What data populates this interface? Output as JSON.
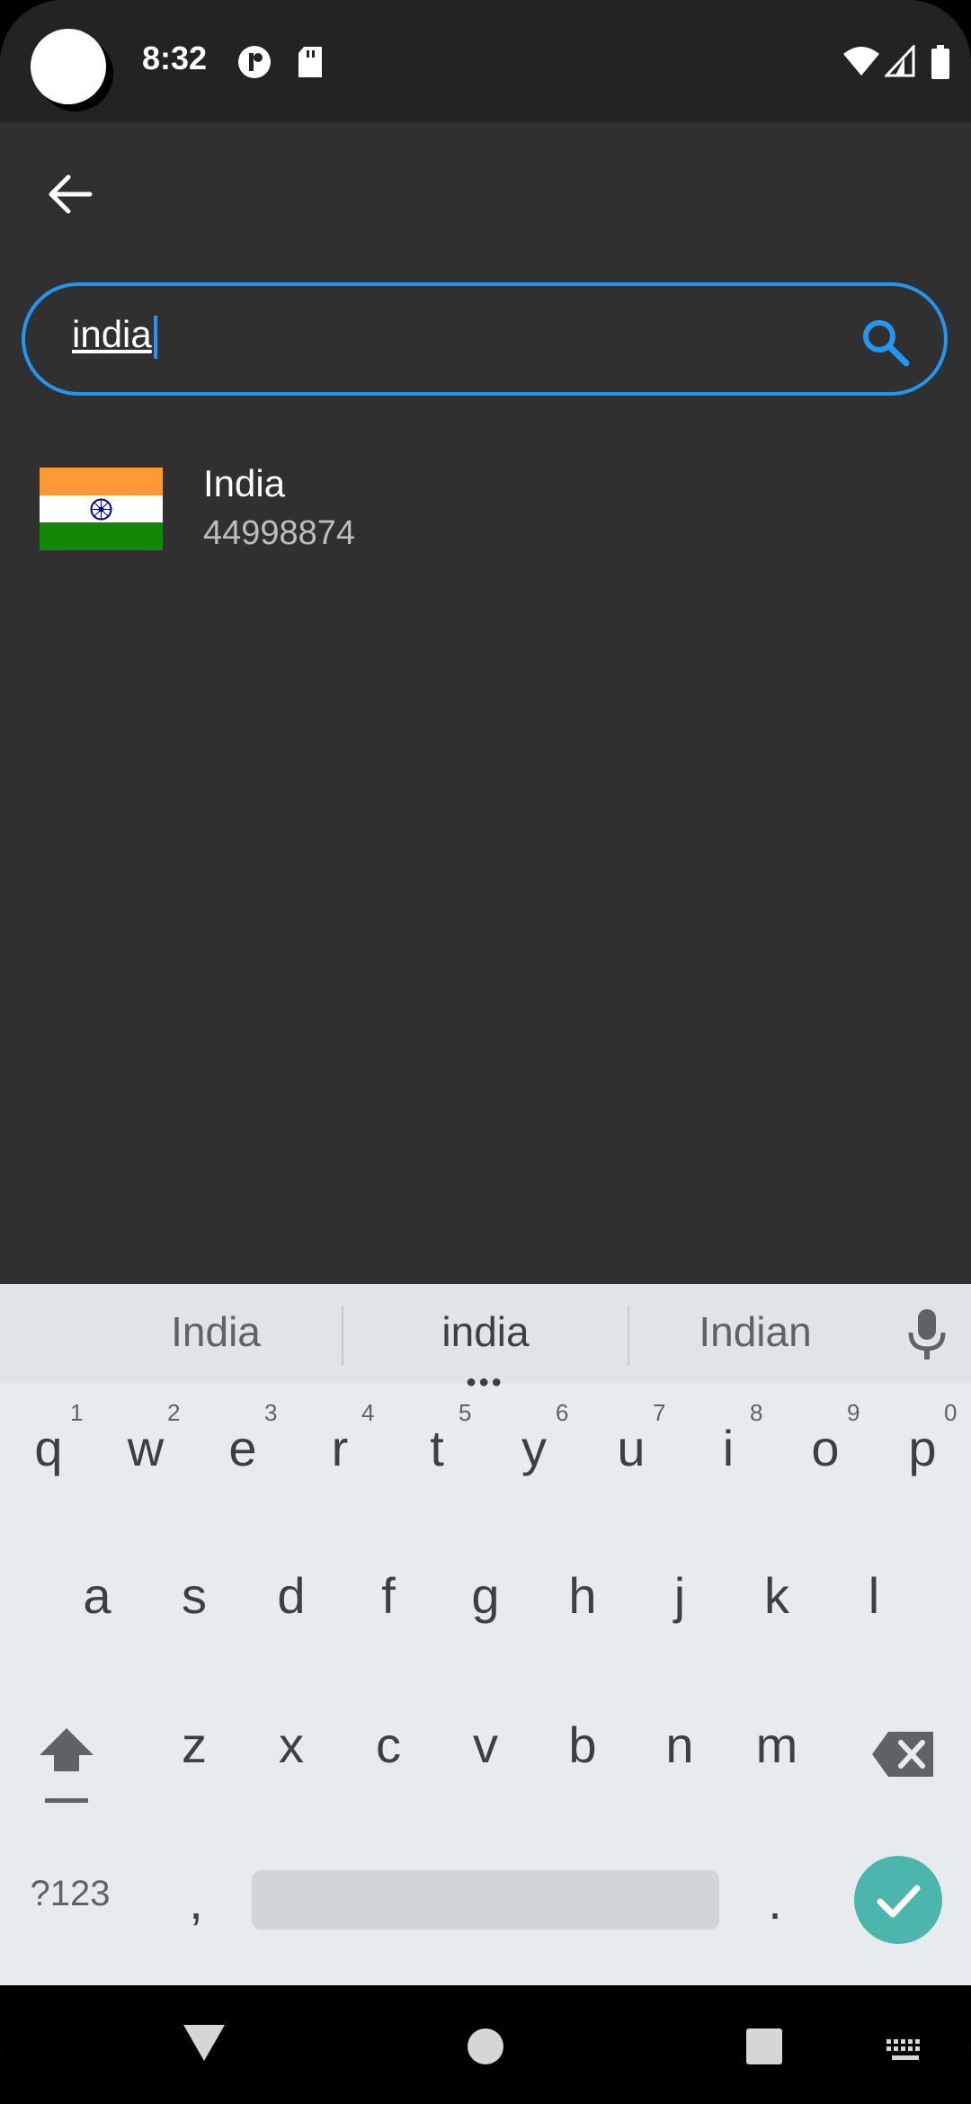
{
  "status_bar": {
    "time": "8:32"
  },
  "search": {
    "query": "india"
  },
  "results": [
    {
      "name": "India",
      "subtitle": "44998874"
    }
  ],
  "keyboard": {
    "suggestions": [
      "India",
      "india",
      "Indian"
    ],
    "row1": [
      "q",
      "w",
      "e",
      "r",
      "t",
      "y",
      "u",
      "i",
      "o",
      "p"
    ],
    "row1_hints": [
      "1",
      "2",
      "3",
      "4",
      "5",
      "6",
      "7",
      "8",
      "9",
      "0"
    ],
    "row2": [
      "a",
      "s",
      "d",
      "f",
      "g",
      "h",
      "j",
      "k",
      "l"
    ],
    "row3": [
      "z",
      "x",
      "c",
      "v",
      "b",
      "n",
      "m"
    ],
    "symbols_label": "?123",
    "comma": ",",
    "period": "."
  },
  "colors": {
    "accent": "#2196F3",
    "enter": "#4db6ac",
    "flag_saffron": "#FF9933",
    "flag_green": "#138808"
  }
}
